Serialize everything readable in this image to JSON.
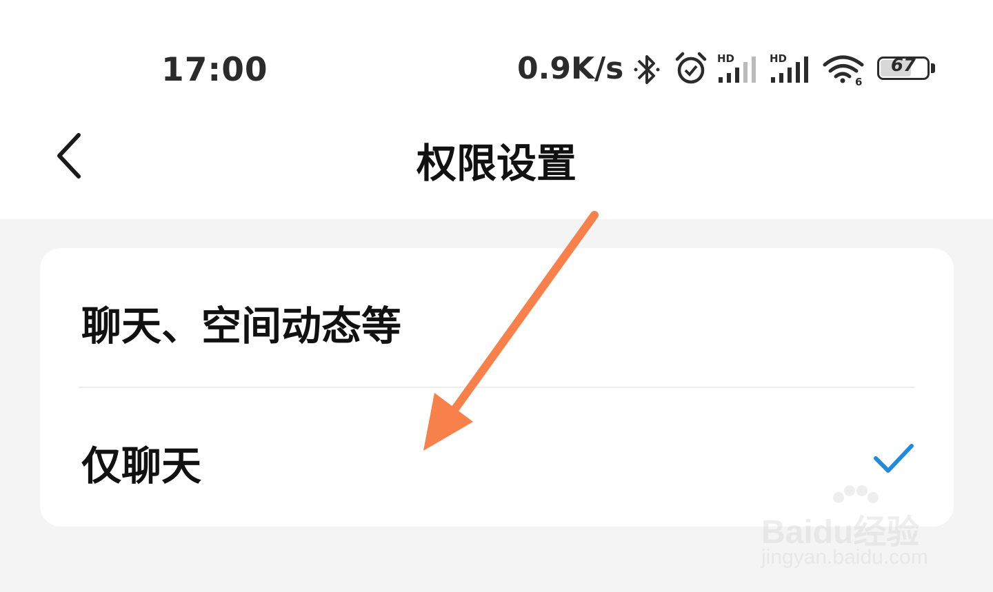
{
  "status_bar": {
    "time": "17:00",
    "network_speed": "0.9K/s",
    "signal_1_label": "HD",
    "signal_2_label": "HD",
    "wifi_label": "6",
    "battery_level": "67"
  },
  "header": {
    "title": "权限设置",
    "back_icon": "chevron-left-icon"
  },
  "options": [
    {
      "label": "聊天、空间动态等",
      "selected": false
    },
    {
      "label": "仅聊天",
      "selected": true
    }
  ],
  "colors": {
    "accent_check": "#1f8be0",
    "annotation_arrow": "#f8804a",
    "background": "#f4f4f4",
    "card": "#ffffff"
  },
  "watermark": {
    "brand": "Baidu经验",
    "url": "jingyan.baidu.com"
  }
}
